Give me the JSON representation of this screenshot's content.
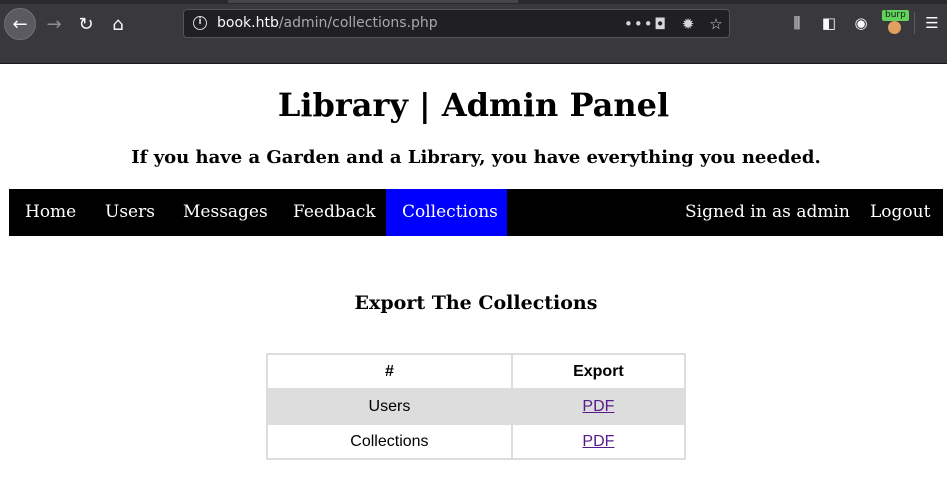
{
  "browser": {
    "url_host": "book.htb",
    "url_path": "/admin/collections.php",
    "back_glyph": "←",
    "forward_glyph": "→",
    "reload_glyph": "↻",
    "home_glyph": "⌂",
    "info_glyph": "i",
    "more_glyph": "•••",
    "pocket_glyph": "◘",
    "bug_glyph": "✹",
    "star_glyph": "☆",
    "library_glyph": "⫼",
    "sidebar_glyph": "◧",
    "account_glyph": "◉",
    "burp_badge": "burp",
    "menu_glyph": "☰",
    "icons": [
      "back-arrow-icon",
      "forward-arrow-icon",
      "reload-icon",
      "home-icon",
      "info-icon",
      "more-actions-icon",
      "pocket-icon",
      "bug-icon",
      "bookmark-star-icon",
      "library-icon",
      "sidebar-icon",
      "account-icon",
      "burp-extension-icon",
      "hamburger-menu-icon"
    ]
  },
  "page": {
    "title": "Library | Admin Panel",
    "subtitle": "If you have a Garden and a Library, you have everything you needed.",
    "nav": {
      "home": "Home",
      "users": "Users",
      "messages": "Messages",
      "feedback": "Feedback",
      "collections": "Collections",
      "signed_in": "Signed in as admin",
      "logout": "Logout",
      "active": "Collections",
      "active_color": "#0000ff"
    },
    "section_heading": "Export The Collections",
    "table": {
      "headers": [
        "#",
        "Export"
      ],
      "rows": [
        {
          "name": "Users",
          "export": "PDF"
        },
        {
          "name": "Collections",
          "export": "PDF"
        }
      ]
    }
  }
}
